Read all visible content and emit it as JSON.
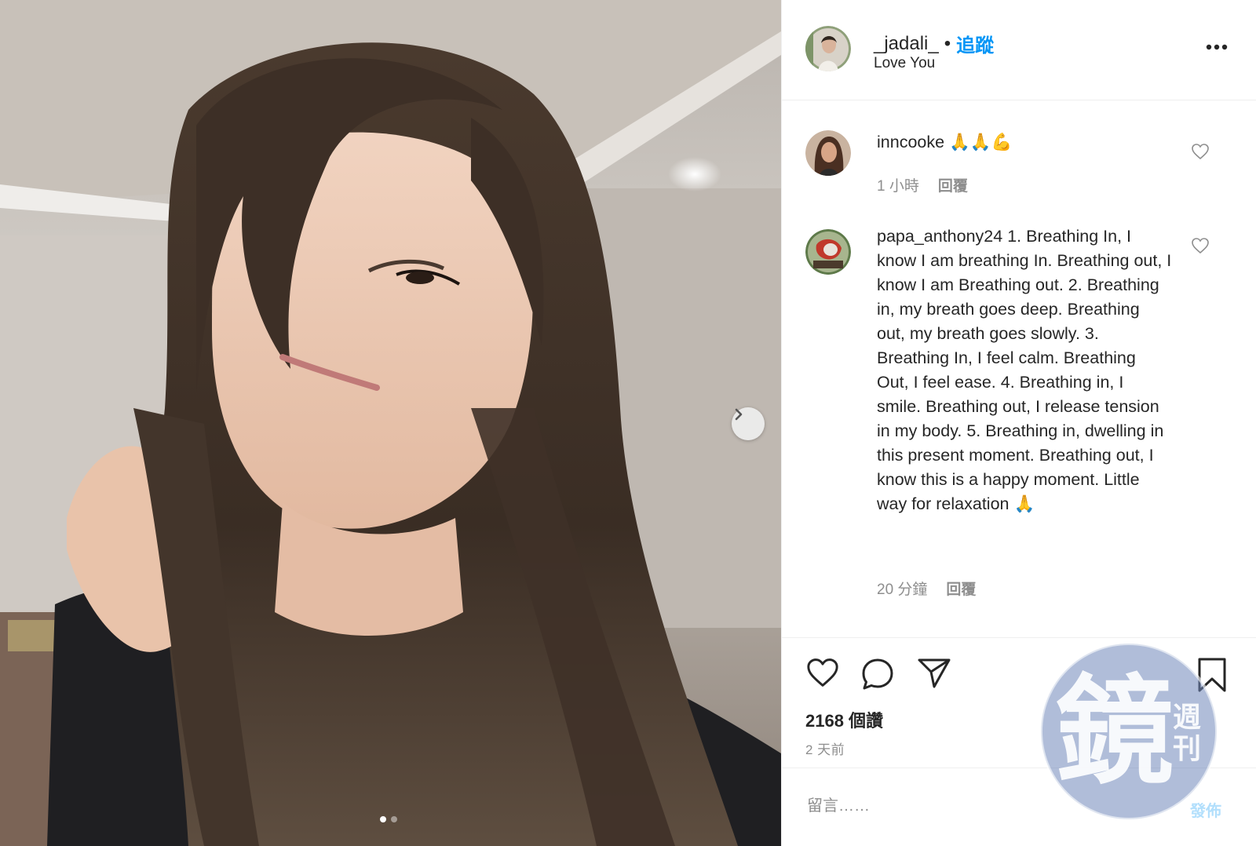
{
  "post": {
    "username": "_jadali_",
    "separator": "•",
    "follow_label": "追蹤",
    "location": "Love You",
    "more_icon": "more-horizontal-icon"
  },
  "photo": {
    "description_icon": "selfie-photo",
    "next_icon": "chevron-right-icon",
    "carousel": {
      "count": 2,
      "active_index": 0
    }
  },
  "comments": [
    {
      "author": "inncooke",
      "text": "🙏🙏💪",
      "time": "1 小時",
      "reply_label": "回覆"
    },
    {
      "author": "papa_anthony24",
      "text": "1. Breathing In, I know I am breathing In. Breathing out, I know I am Breathing out. 2. Breathing in, my breath goes deep. Breathing out, my breath goes slowly. 3. Breathing In, I feel calm. Breathing Out, I feel ease. 4. Breathing in, I smile. Breathing out, I release tension in my body. 5. Breathing in, dwelling in this present moment. Breathing out, I know this is a happy moment. Little way for relaxation 🙏",
      "time": "20 分鐘",
      "reply_label": "回覆"
    }
  ],
  "actions": {
    "like_icon": "heart-icon",
    "comment_icon": "comment-bubble-icon",
    "share_icon": "paper-plane-icon",
    "save_icon": "bookmark-icon",
    "likes_text": "2168 個讚",
    "time_ago": "2 天前"
  },
  "comment_box": {
    "placeholder": "留言……",
    "post_label": "發佈"
  },
  "watermark": {
    "main_char": "鏡",
    "sub_chars": "週刊"
  },
  "colors": {
    "accent": "#0095f6",
    "text": "#262626",
    "muted": "#8e8e8e",
    "post_disabled": "#b2dffc"
  }
}
